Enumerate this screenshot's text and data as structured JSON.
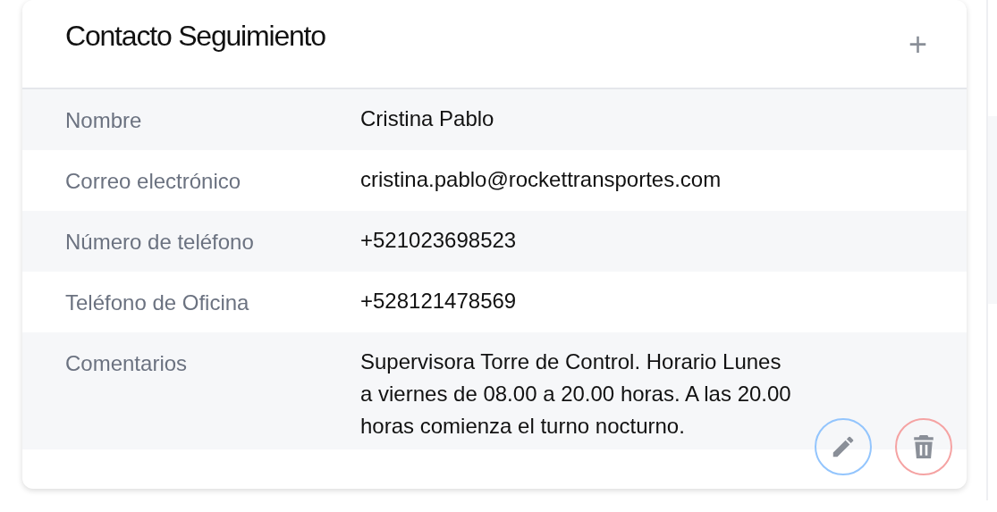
{
  "card": {
    "title": "Contacto Seguimiento",
    "add_symbol": "+"
  },
  "fields": [
    {
      "label": "Nombre",
      "value": "Cristina Pablo"
    },
    {
      "label": "Correo electrónico",
      "value": "cristina.pablo@rockettransportes.com"
    },
    {
      "label": "Número de teléfono",
      "value": "+521023698523"
    },
    {
      "label": "Teléfono de Oficina",
      "value": "+528121478569"
    },
    {
      "label": "Comentarios",
      "value": "Supervisora Torre de Control. Horario Lunes a viernes de 08.00 a 20.00 horas. A las 20.00 horas comienza el turno nocturno."
    }
  ]
}
